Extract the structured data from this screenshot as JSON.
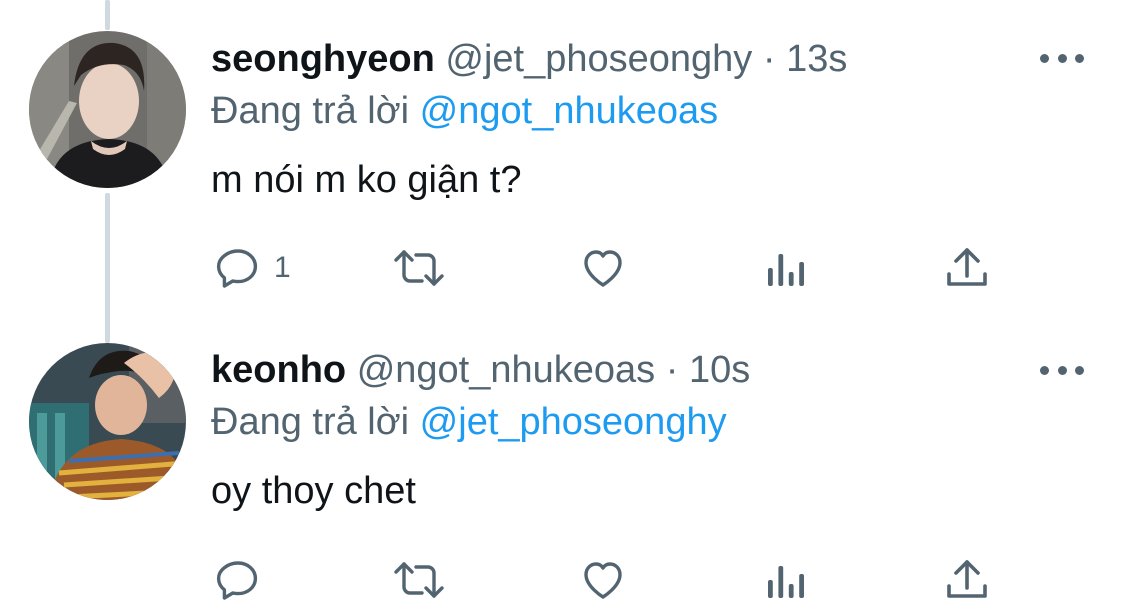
{
  "tweets": [
    {
      "display_name": "seonghyeon",
      "handle": "@jet_phoseonghy",
      "separator": "·",
      "time": "13s",
      "reply_prefix": "Đang trả lời",
      "reply_to": "@ngot_nhukeoas",
      "text": "m nói m ko giận t?",
      "reply_count": "1"
    },
    {
      "display_name": "keonho",
      "handle": "@ngot_nhukeoas",
      "separator": "·",
      "time": "10s",
      "reply_prefix": "Đang trả lời",
      "reply_to": "@jet_phoseonghy",
      "text": "oy thoy chet",
      "reply_count": ""
    }
  ],
  "icons": {
    "reply": "reply-icon",
    "retweet": "retweet-icon",
    "like": "heart-icon",
    "analytics": "analytics-icon",
    "share": "share-icon",
    "more": "more-icon"
  },
  "colors": {
    "link": "#1d9bf0",
    "secondary_text": "#536471",
    "thread_line": "#cfd9de"
  }
}
